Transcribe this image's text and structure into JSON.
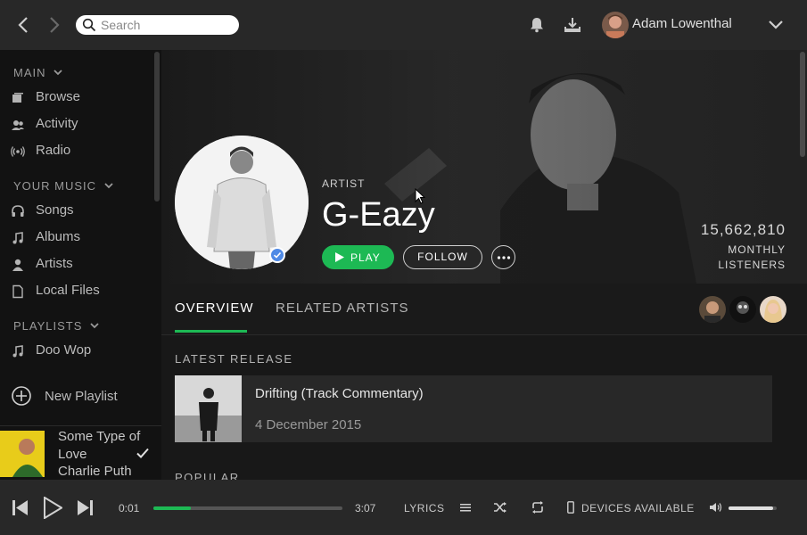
{
  "header": {
    "search_placeholder": "Search",
    "user_name": "Adam Lowenthal"
  },
  "sidebar": {
    "main_title": "MAIN",
    "main_items": [
      {
        "label": "Browse",
        "icon": "browse-icon"
      },
      {
        "label": "Activity",
        "icon": "activity-icon"
      },
      {
        "label": "Radio",
        "icon": "radio-icon"
      }
    ],
    "your_music_title": "YOUR MUSIC",
    "your_music_items": [
      {
        "label": "Songs",
        "icon": "headphones-icon"
      },
      {
        "label": "Albums",
        "icon": "note-icon"
      },
      {
        "label": "Artists",
        "icon": "person-icon"
      },
      {
        "label": "Local Files",
        "icon": "file-icon"
      }
    ],
    "playlists_title": "PLAYLISTS",
    "playlists": [
      {
        "label": "Doo Wop",
        "icon": "note-icon"
      }
    ],
    "new_playlist_label": "New Playlist",
    "now_playing": {
      "title": "Some Type of Love",
      "artist": "Charlie Puth"
    }
  },
  "artist": {
    "type_label": "ARTIST",
    "name": "G-Eazy",
    "play_label": "PLAY",
    "follow_label": "FOLLOW",
    "monthly_listeners": "15,662,810",
    "listeners_label_1": "MONTHLY",
    "listeners_label_2": "LISTENERS"
  },
  "tabs": [
    {
      "label": "OVERVIEW",
      "active": true
    },
    {
      "label": "RELATED ARTISTS",
      "active": false
    }
  ],
  "content": {
    "latest_release_title": "LATEST RELEASE",
    "release": {
      "title": "Drifting (Track Commentary)",
      "date": "4 December 2015"
    },
    "popular_title": "POPULAR"
  },
  "player": {
    "elapsed": "0:01",
    "duration": "3:07",
    "progress_fraction": 0.2,
    "lyrics_label": "LYRICS",
    "devices_label": "DEVICES AVAILABLE",
    "volume_fraction": 0.92
  },
  "colors": {
    "accent": "#1db954",
    "verified": "#4f8ae6"
  }
}
